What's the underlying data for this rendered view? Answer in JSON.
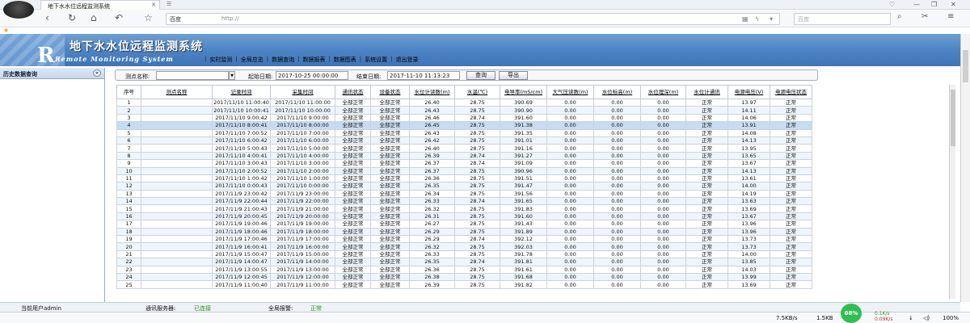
{
  "browser": {
    "tab_title": "地下水水位远程监测系统",
    "engine": "百度",
    "url": "http://",
    "search_placeholder": "百度"
  },
  "banner": {
    "title": "地下水水位远程监测系统",
    "subtitle": "Remote Monitoring System",
    "big_letter": "R"
  },
  "menu": [
    "实时监测",
    "全局总览",
    "数据查询",
    "数据报表",
    "数据图表",
    "系统设置",
    "退出登录"
  ],
  "sidebar": {
    "title": "历史数据查询"
  },
  "filter": {
    "station_label": "测点名称:",
    "start_label": "起始日期:",
    "start_value": "2017-10-25 00:00:00",
    "end_label": "结束日期:",
    "end_value": "2017-11-10 11:13:23",
    "query_btn": "查询",
    "export_btn": "导出"
  },
  "table": {
    "headers": [
      "序号",
      "测点名称",
      "记录时间",
      "采集时间",
      "通讯状态",
      "设备状态",
      "水位计读数(m)",
      "水温(℃)",
      "电导率(mS/cm)",
      "大气压读数(m)",
      "水位标高(m)",
      "水位埋深(m)",
      "水位计通讯",
      "电源电压(V)",
      "电源电压状态"
    ],
    "rows": [
      [
        "1",
        "",
        "2017/11/10 11:00:40",
        "2017/11/10 11:00:00",
        "全部正常",
        "全部正常",
        "26.40",
        "28.75",
        "390.69",
        "0.00",
        "0.00",
        "0.00",
        "正常",
        "13.97",
        "正常"
      ],
      [
        "2",
        "",
        "2017/11/10 10:00:41",
        "2017/11/10 10:00:00",
        "全部正常",
        "全部正常",
        "26.43",
        "28.75",
        "390.90",
        "0.00",
        "0.00",
        "0.00",
        "正常",
        "14.11",
        "正常"
      ],
      [
        "3",
        "",
        "2017/11/10 9:00:42",
        "2017/11/10 9:00:00",
        "全部正常",
        "全部正常",
        "26.46",
        "28.74",
        "391.60",
        "0.00",
        "0.00",
        "0.00",
        "正常",
        "14.06",
        "正常"
      ],
      [
        "4",
        "",
        "2017/11/10 8:00:41",
        "2017/11/10 8:00:00",
        "全部正常",
        "全部正常",
        "26.45",
        "28.75",
        "391.38",
        "0.00",
        "0.00",
        "0.00",
        "正常",
        "13.91",
        "正常"
      ],
      [
        "5",
        "",
        "2017/11/10 7:00:52",
        "2017/11/10 7:00:00",
        "全部正常",
        "全部正常",
        "26.43",
        "28.75",
        "391.35",
        "0.00",
        "0.00",
        "0.00",
        "正常",
        "14.08",
        "正常"
      ],
      [
        "6",
        "",
        "2017/11/10 6:00:42",
        "2017/11/10 6:00:00",
        "全部正常",
        "全部正常",
        "26.42",
        "28.75",
        "391.01",
        "0.00",
        "0.00",
        "0.00",
        "正常",
        "14.13",
        "正常"
      ],
      [
        "7",
        "",
        "2017/11/10 5:00:43",
        "2017/11/10 5:00:00",
        "全部正常",
        "全部正常",
        "26.40",
        "28.75",
        "391.16",
        "0.00",
        "0.00",
        "0.00",
        "正常",
        "13.95",
        "正常"
      ],
      [
        "8",
        "",
        "2017/11/10 4:00:41",
        "2017/11/10 4:00:00",
        "全部正常",
        "全部正常",
        "26.39",
        "28.74",
        "391.27",
        "0.00",
        "0.00",
        "0.00",
        "正常",
        "13.65",
        "正常"
      ],
      [
        "9",
        "",
        "2017/11/10 3:00:43",
        "2017/11/10 3:00:00",
        "全部正常",
        "全部正常",
        "26.37",
        "28.74",
        "391.09",
        "0.00",
        "0.00",
        "0.00",
        "正常",
        "13.67",
        "正常"
      ],
      [
        "10",
        "",
        "2017/11/10 2:00:52",
        "2017/11/10 2:00:00",
        "全部正常",
        "全部正常",
        "26.37",
        "28.75",
        "390.96",
        "0.00",
        "0.00",
        "0.00",
        "正常",
        "14.13",
        "正常"
      ],
      [
        "11",
        "",
        "2017/11/10 1:00:42",
        "2017/11/10 1:00:00",
        "全部正常",
        "全部正常",
        "26.36",
        "28.75",
        "391.51",
        "0.00",
        "0.00",
        "0.00",
        "正常",
        "13.61",
        "正常"
      ],
      [
        "12",
        "",
        "2017/11/10 0:00:43",
        "2017/11/10 0:00:00",
        "全部正常",
        "全部正常",
        "26.35",
        "28.75",
        "391.47",
        "0.00",
        "0.00",
        "0.00",
        "正常",
        "14.00",
        "正常"
      ],
      [
        "13",
        "",
        "2017/11/9 23:00:42",
        "2017/11/9 23:00:00",
        "全部正常",
        "全部正常",
        "26.34",
        "28.75",
        "391.56",
        "0.00",
        "0.00",
        "0.00",
        "正常",
        "14.19",
        "正常"
      ],
      [
        "14",
        "",
        "2017/11/9 22:00:44",
        "2017/11/9 22:00:00",
        "全部正常",
        "全部正常",
        "26.33",
        "28.74",
        "391.65",
        "0.00",
        "0.00",
        "0.00",
        "正常",
        "13.63",
        "正常"
      ],
      [
        "15",
        "",
        "2017/11/9 21:00:43",
        "2017/11/9 21:00:00",
        "全部正常",
        "全部正常",
        "26.32",
        "28.75",
        "391.83",
        "0.00",
        "0.00",
        "0.00",
        "正常",
        "13.69",
        "正常"
      ],
      [
        "16",
        "",
        "2017/11/9 20:00:45",
        "2017/11/9 20:00:00",
        "全部正常",
        "全部正常",
        "26.31",
        "28.75",
        "391.60",
        "0.00",
        "0.00",
        "0.00",
        "正常",
        "13.67",
        "正常"
      ],
      [
        "17",
        "",
        "2017/11/9 19:00:46",
        "2017/11/9 19:00:00",
        "全部正常",
        "全部正常",
        "26.27",
        "28.75",
        "391.43",
        "0.00",
        "0.00",
        "0.00",
        "正常",
        "13.96",
        "正常"
      ],
      [
        "18",
        "",
        "2017/11/9 18:00:46",
        "2017/11/9 18:00:00",
        "全部正常",
        "全部正常",
        "26.29",
        "28.75",
        "391.89",
        "0.00",
        "0.00",
        "0.00",
        "正常",
        "13.96",
        "正常"
      ],
      [
        "19",
        "",
        "2017/11/9 17:00:46",
        "2017/11/9 17:00:00",
        "全部正常",
        "全部正常",
        "26.29",
        "28.74",
        "392.12",
        "0.00",
        "0.00",
        "0.00",
        "正常",
        "13.73",
        "正常"
      ],
      [
        "20",
        "",
        "2017/11/9 16:00:41",
        "2017/11/9 16:00:00",
        "全部正常",
        "全部正常",
        "26.32",
        "28.75",
        "392.03",
        "0.00",
        "0.00",
        "0.00",
        "正常",
        "13.73",
        "正常"
      ],
      [
        "21",
        "",
        "2017/11/9 15:00:47",
        "2017/11/9 15:00:00",
        "全部正常",
        "全部正常",
        "26.33",
        "28.75",
        "391.78",
        "0.00",
        "0.00",
        "0.00",
        "正常",
        "14.00",
        "正常"
      ],
      [
        "22",
        "",
        "2017/11/9 14:00:47",
        "2017/11/9 14:00:00",
        "全部正常",
        "全部正常",
        "26.35",
        "28.74",
        "391.81",
        "0.00",
        "0.00",
        "0.00",
        "正常",
        "13.85",
        "正常"
      ],
      [
        "23",
        "",
        "2017/11/9 13:00:55",
        "2017/11/9 13:00:00",
        "全部正常",
        "全部正常",
        "26.36",
        "28.75",
        "391.61",
        "0.00",
        "0.00",
        "0.00",
        "正常",
        "14.03",
        "正常"
      ],
      [
        "24",
        "",
        "2017/11/9 12:00:45",
        "2017/11/9 12:00:00",
        "全部正常",
        "全部正常",
        "26.38",
        "28.75",
        "391.68",
        "0.00",
        "0.00",
        "0.00",
        "正常",
        "13.99",
        "正常"
      ],
      [
        "25",
        "",
        "2017/11/9 11:00:40",
        "2017/11/9 11:00:00",
        "全部正常",
        "全部正常",
        "26.39",
        "28.75",
        "391.82",
        "0.00",
        "0.00",
        "0.00",
        "正常",
        "13.69",
        "正常"
      ]
    ]
  },
  "footer": {
    "user": "当前用户admin",
    "comm_label": "通讯服务器:",
    "comm_value": "已连接",
    "alarm_label": "全局报警:",
    "alarm_value": "正常"
  },
  "statusbar": {
    "net1": "7.5KB/s",
    "net2": "1.5KB",
    "gauge": "68%",
    "up": "0.1K/s",
    "down": "0.09K/s",
    "zoom": "100%"
  },
  "colors": {
    "banner": "#4d84c4",
    "comm_ok": "#1a9a1a",
    "selected_row": "#c7dcf3"
  }
}
